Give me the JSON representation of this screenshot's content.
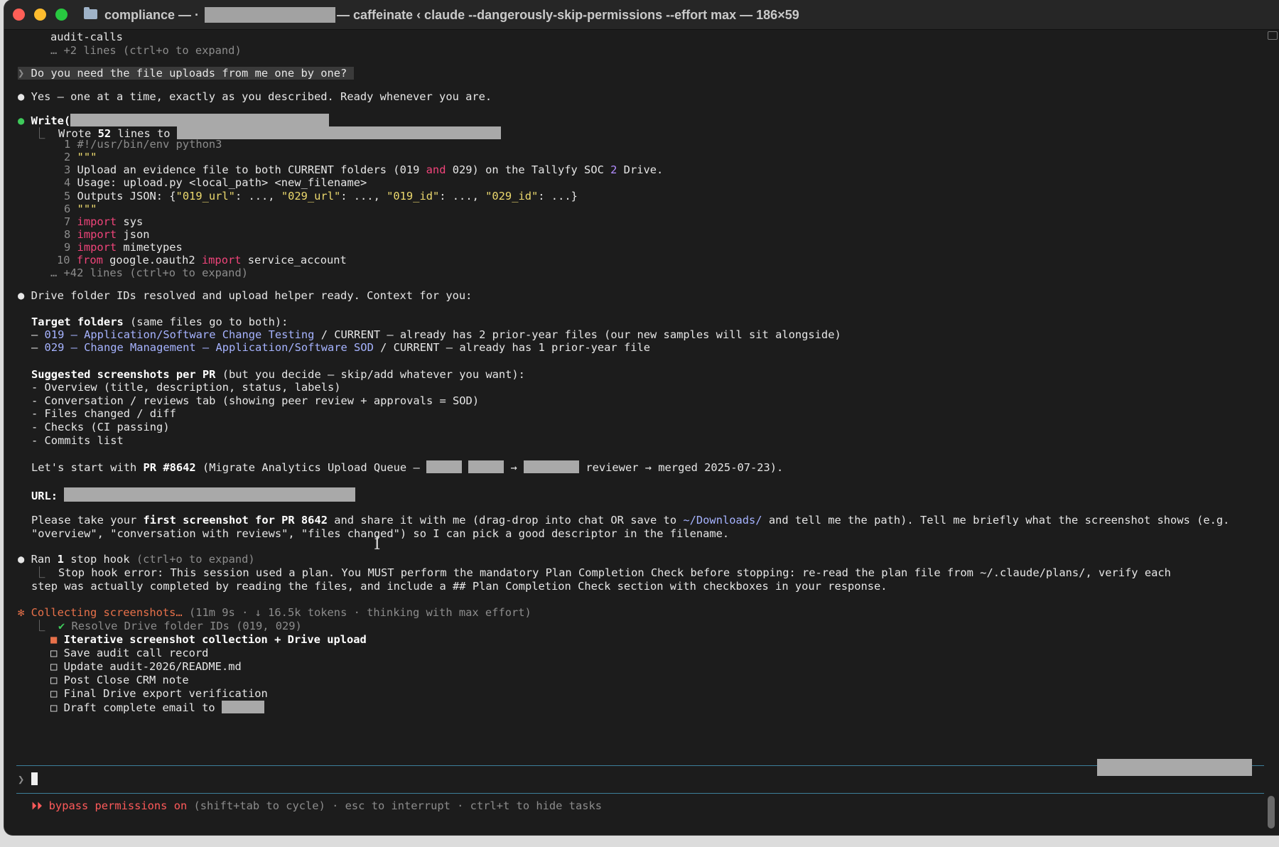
{
  "window": {
    "title_prefix": "compliance — ·",
    "title_suffix": "— caffeinate ‹ claude --dangerously-skip-permissions --effort max — 186×59"
  },
  "lines": {
    "audit_calls": "audit-calls",
    "expand1": "… +2 lines (ctrl+o to expand)",
    "user_prompt": "Do you need the file uploads from me one by one?",
    "reply1": "Yes — one at a time, exactly as you described. Ready whenever you are.",
    "write_tool": "Write(",
    "wrote_a": "Wrote ",
    "wrote_num": "52",
    "wrote_b": " lines to ",
    "code": {
      "l1": "#!/usr/bin/env python3",
      "l2": "\"\"\"",
      "l3_a": "Upload an evidence file to both CURRENT folders (019 ",
      "l3_and": "and",
      "l3_b": " 029) on the Tallyfy SOC ",
      "l3_num": "2",
      "l3_c": " Drive.",
      "l4": "Usage: upload.py <local_path> <new_filename>",
      "l5_a": "Outputs JSON: {",
      "l5_k1": "\"019_url\"",
      "l5_k2": "\"029_url\"",
      "l5_k3": "\"019_id\"",
      "l5_k4": "\"029_id\"",
      "l5_sep": ": ..., ",
      "l5_end": ": ...}",
      "l6": "\"\"\"",
      "import": "import",
      "from": "from",
      "sys": " sys",
      "json": " json",
      "mimetypes": " mimetypes",
      "google": " google.oauth2 ",
      "service": " service_account"
    },
    "expand2": "… +42 lines (ctrl+o to expand)",
    "context": "Drive folder IDs resolved and upload helper ready. Context for you:",
    "target_b": "Target folders",
    "target_rest": " (same files go to both):",
    "f1_link": "019 – Application/Software Change Testing",
    "f1_rest": " / CURRENT — already has 2 prior-year files (our new samples will sit alongside)",
    "f2_link": "029 – Change Management – Application/Software SOD",
    "f2_rest": " / CURRENT — already has 1 prior-year file",
    "sugg_b": "Suggested screenshots per PR",
    "sugg_rest": " (but you decide — skip/add whatever you want):",
    "s1": "- Overview (title, description, status, labels)",
    "s2": "- Conversation / reviews tab (showing peer review + approvals = SOD)",
    "s3": "- Files changed / diff",
    "s4": "- Checks (CI passing)",
    "s5": "- Commits list",
    "start_a": "Let's start with ",
    "start_b": "PR #8642",
    "start_c": " (Migrate Analytics Upload Queue — ",
    "start_d": " reviewer → merged 2025-07-23).",
    "url_label": "URL:",
    "please_a": "Please take your ",
    "please_b": "first screenshot for PR 8642",
    "please_c": " and share it with me (drag-drop into chat OR save to ",
    "please_link": "~/Downloads/",
    "please_d": " and tell me the path). Tell me briefly what the screenshot shows (e.g.",
    "please_2": "\"overview\", \"conversation with reviews\", \"files changed\") so I can pick a good descriptor in the filename.",
    "ran_a": "Ran ",
    "ran_num": "1",
    "ran_b": " stop hook",
    "ran_c": " (ctrl+o to expand)",
    "hook1": "Stop hook error: This session used a plan. You MUST perform the mandatory Plan Completion Check before stopping: re-read the plan file from ~/.claude/plans/, verify each",
    "hook2": "step was actually completed by reading the files, and include a ## Plan Completion Check section with checkboxes in your response.",
    "collecting": "Collecting screenshots…",
    "collecting_meta": " (11m 9s · ↓ 16.5k tokens · thinking with max effort)",
    "tasks": {
      "t1": "Resolve Drive folder IDs (019, 029)",
      "t2": "Iterative screenshot collection + Drive upload",
      "t3": "Save audit call record",
      "t4": "Update audit-2026/README.md",
      "t5": "Post Close CRM note",
      "t6": "Final Drive export verification",
      "t7": "Draft complete email to "
    },
    "status_a": "⏵⏵ bypass permissions on",
    "status_b": " (shift+tab to cycle) · esc to interrupt · ctrl+t to hide tasks"
  }
}
